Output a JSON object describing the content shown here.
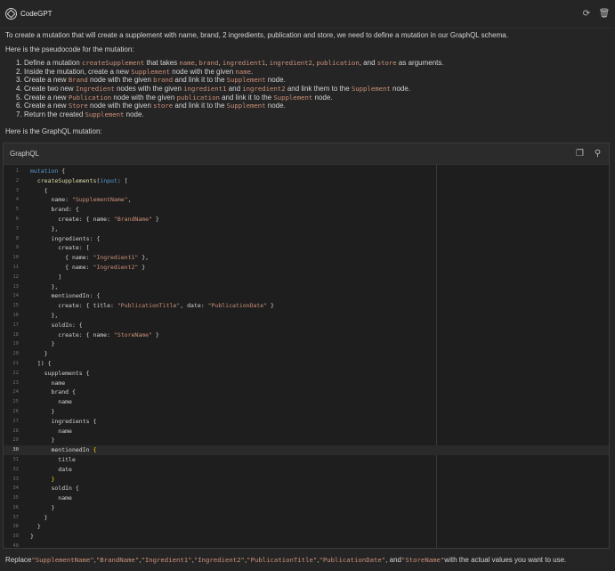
{
  "app": {
    "title": "CodeGPT"
  },
  "header": {
    "refresh_icon": "refresh-icon",
    "trash_icon": "trash-icon"
  },
  "intro": "To create a mutation that will create a supplement with name, brand, 2 ingredients, publication and store, we need to define a mutation in our GraphQL schema.",
  "pseudo_intro": "Here is the pseudocode for the mutation:",
  "steps": [
    {
      "n": "1.",
      "parts": [
        [
          "t",
          "Define a mutation "
        ],
        [
          "c",
          "createSupplement"
        ],
        [
          "t",
          " that takes "
        ],
        [
          "c",
          "name"
        ],
        [
          "t",
          ", "
        ],
        [
          "c",
          "brand"
        ],
        [
          "t",
          ", "
        ],
        [
          "c",
          "ingredient1"
        ],
        [
          "t",
          ", "
        ],
        [
          "c",
          "ingredient2"
        ],
        [
          "t",
          ", "
        ],
        [
          "c",
          "publication"
        ],
        [
          "t",
          ", and "
        ],
        [
          "c",
          "store"
        ],
        [
          "t",
          " as arguments."
        ]
      ]
    },
    {
      "n": "2.",
      "parts": [
        [
          "t",
          "Inside the mutation, create a new "
        ],
        [
          "c",
          "Supplement"
        ],
        [
          "t",
          " node with the given "
        ],
        [
          "c",
          "name"
        ],
        [
          "t",
          "."
        ]
      ]
    },
    {
      "n": "3.",
      "parts": [
        [
          "t",
          "Create a new "
        ],
        [
          "c",
          "Brand"
        ],
        [
          "t",
          " node with the given "
        ],
        [
          "c",
          "brand"
        ],
        [
          "t",
          " and link it to the "
        ],
        [
          "c",
          "Supplement"
        ],
        [
          "t",
          " node."
        ]
      ]
    },
    {
      "n": "4.",
      "parts": [
        [
          "t",
          "Create two new "
        ],
        [
          "c",
          "Ingredient"
        ],
        [
          "t",
          " nodes with the given "
        ],
        [
          "c",
          "ingredient1"
        ],
        [
          "t",
          " and "
        ],
        [
          "c",
          "ingredient2"
        ],
        [
          "t",
          " and link them to the "
        ],
        [
          "c",
          "Supplement"
        ],
        [
          "t",
          " node."
        ]
      ]
    },
    {
      "n": "5.",
      "parts": [
        [
          "t",
          "Create a new "
        ],
        [
          "c",
          "Publication"
        ],
        [
          "t",
          " node with the given "
        ],
        [
          "c",
          "publication"
        ],
        [
          "t",
          " and link it to the "
        ],
        [
          "c",
          "Supplement"
        ],
        [
          "t",
          " node."
        ]
      ]
    },
    {
      "n": "6.",
      "parts": [
        [
          "t",
          "Create a new "
        ],
        [
          "c",
          "Store"
        ],
        [
          "t",
          " node with the given "
        ],
        [
          "c",
          "store"
        ],
        [
          "t",
          " and link it to the "
        ],
        [
          "c",
          "Supplement"
        ],
        [
          "t",
          " node."
        ]
      ]
    },
    {
      "n": "7.",
      "parts": [
        [
          "t",
          "Return the created "
        ],
        [
          "c",
          "Supplement"
        ],
        [
          "t",
          " node."
        ]
      ]
    }
  ],
  "mutation_intro": "Here is the GraphQL mutation:",
  "code_block": {
    "language": "GraphQL",
    "copy_icon": "copy-icon",
    "insert_icon": "insert-icon",
    "active_line": 30,
    "lines": [
      [
        [
          "kw",
          "mutation"
        ],
        [
          "plain",
          " {"
        ]
      ],
      [
        [
          "plain",
          "  "
        ],
        [
          "fn",
          "createSupplements"
        ],
        [
          "plain",
          "("
        ],
        [
          "kw",
          "input"
        ],
        [
          "plain",
          ": ["
        ]
      ],
      [
        [
          "plain",
          "    {"
        ]
      ],
      [
        [
          "plain",
          "      name: "
        ],
        [
          "str",
          "\"SupplementName\""
        ],
        [
          "plain",
          ","
        ]
      ],
      [
        [
          "plain",
          "      brand: {"
        ]
      ],
      [
        [
          "plain",
          "        create: { name: "
        ],
        [
          "str",
          "\"BrandName\""
        ],
        [
          "plain",
          " }"
        ]
      ],
      [
        [
          "plain",
          "      },"
        ]
      ],
      [
        [
          "plain",
          "      ingredients: {"
        ]
      ],
      [
        [
          "plain",
          "        create: ["
        ]
      ],
      [
        [
          "plain",
          "          { name: "
        ],
        [
          "str",
          "\"Ingredient1\""
        ],
        [
          "plain",
          " },"
        ]
      ],
      [
        [
          "plain",
          "          { name: "
        ],
        [
          "str",
          "\"Ingredient2\""
        ],
        [
          "plain",
          " }"
        ]
      ],
      [
        [
          "plain",
          "        ]"
        ]
      ],
      [
        [
          "plain",
          "      },"
        ]
      ],
      [
        [
          "plain",
          "      mentionedIn: {"
        ]
      ],
      [
        [
          "plain",
          "        create: { title: "
        ],
        [
          "str",
          "\"PublicationTitle\""
        ],
        [
          "plain",
          ", date: "
        ],
        [
          "str",
          "\"PublicationDate\""
        ],
        [
          "plain",
          " }"
        ]
      ],
      [
        [
          "plain",
          "      },"
        ]
      ],
      [
        [
          "plain",
          "      soldIn: {"
        ]
      ],
      [
        [
          "plain",
          "        create: { name: "
        ],
        [
          "str",
          "\"StoreName\""
        ],
        [
          "plain",
          " }"
        ]
      ],
      [
        [
          "plain",
          "      }"
        ]
      ],
      [
        [
          "plain",
          "    }"
        ]
      ],
      [
        [
          "plain",
          "  ]) {"
        ]
      ],
      [
        [
          "plain",
          "    supplements {"
        ]
      ],
      [
        [
          "plain",
          "      name"
        ]
      ],
      [
        [
          "plain",
          "      brand {"
        ]
      ],
      [
        [
          "plain",
          "        name"
        ]
      ],
      [
        [
          "plain",
          "      }"
        ]
      ],
      [
        [
          "plain",
          "      ingredients {"
        ]
      ],
      [
        [
          "plain",
          "        name"
        ]
      ],
      [
        [
          "plain",
          "      }"
        ]
      ],
      [
        [
          "plain",
          "      mentionedIn "
        ],
        [
          "brace",
          "{"
        ]
      ],
      [
        [
          "plain",
          "        title"
        ]
      ],
      [
        [
          "plain",
          "        date"
        ]
      ],
      [
        [
          "plain",
          "      "
        ],
        [
          "brace",
          "}"
        ]
      ],
      [
        [
          "plain",
          "      soldIn {"
        ]
      ],
      [
        [
          "plain",
          "        name"
        ]
      ],
      [
        [
          "plain",
          "      }"
        ]
      ],
      [
        [
          "plain",
          "    }"
        ]
      ],
      [
        [
          "plain",
          "  }"
        ]
      ],
      [
        [
          "plain",
          "}"
        ]
      ],
      [
        [
          "plain",
          ""
        ]
      ]
    ]
  },
  "footer_parts": [
    [
      "t",
      "Replace "
    ],
    [
      "c",
      "\"SupplementName\""
    ],
    [
      "t",
      ", "
    ],
    [
      "c",
      "\"BrandName\""
    ],
    [
      "t",
      ", "
    ],
    [
      "c",
      "\"Ingredient1\""
    ],
    [
      "t",
      ", "
    ],
    [
      "c",
      "\"Ingredient2\""
    ],
    [
      "t",
      ", "
    ],
    [
      "c",
      "\"PublicationTitle\""
    ],
    [
      "t",
      ", "
    ],
    [
      "c",
      "\"PublicationDate\""
    ],
    [
      "t",
      ", and "
    ],
    [
      "c",
      "\"StoreName\""
    ],
    [
      "t",
      " with the actual values you want to use."
    ]
  ]
}
